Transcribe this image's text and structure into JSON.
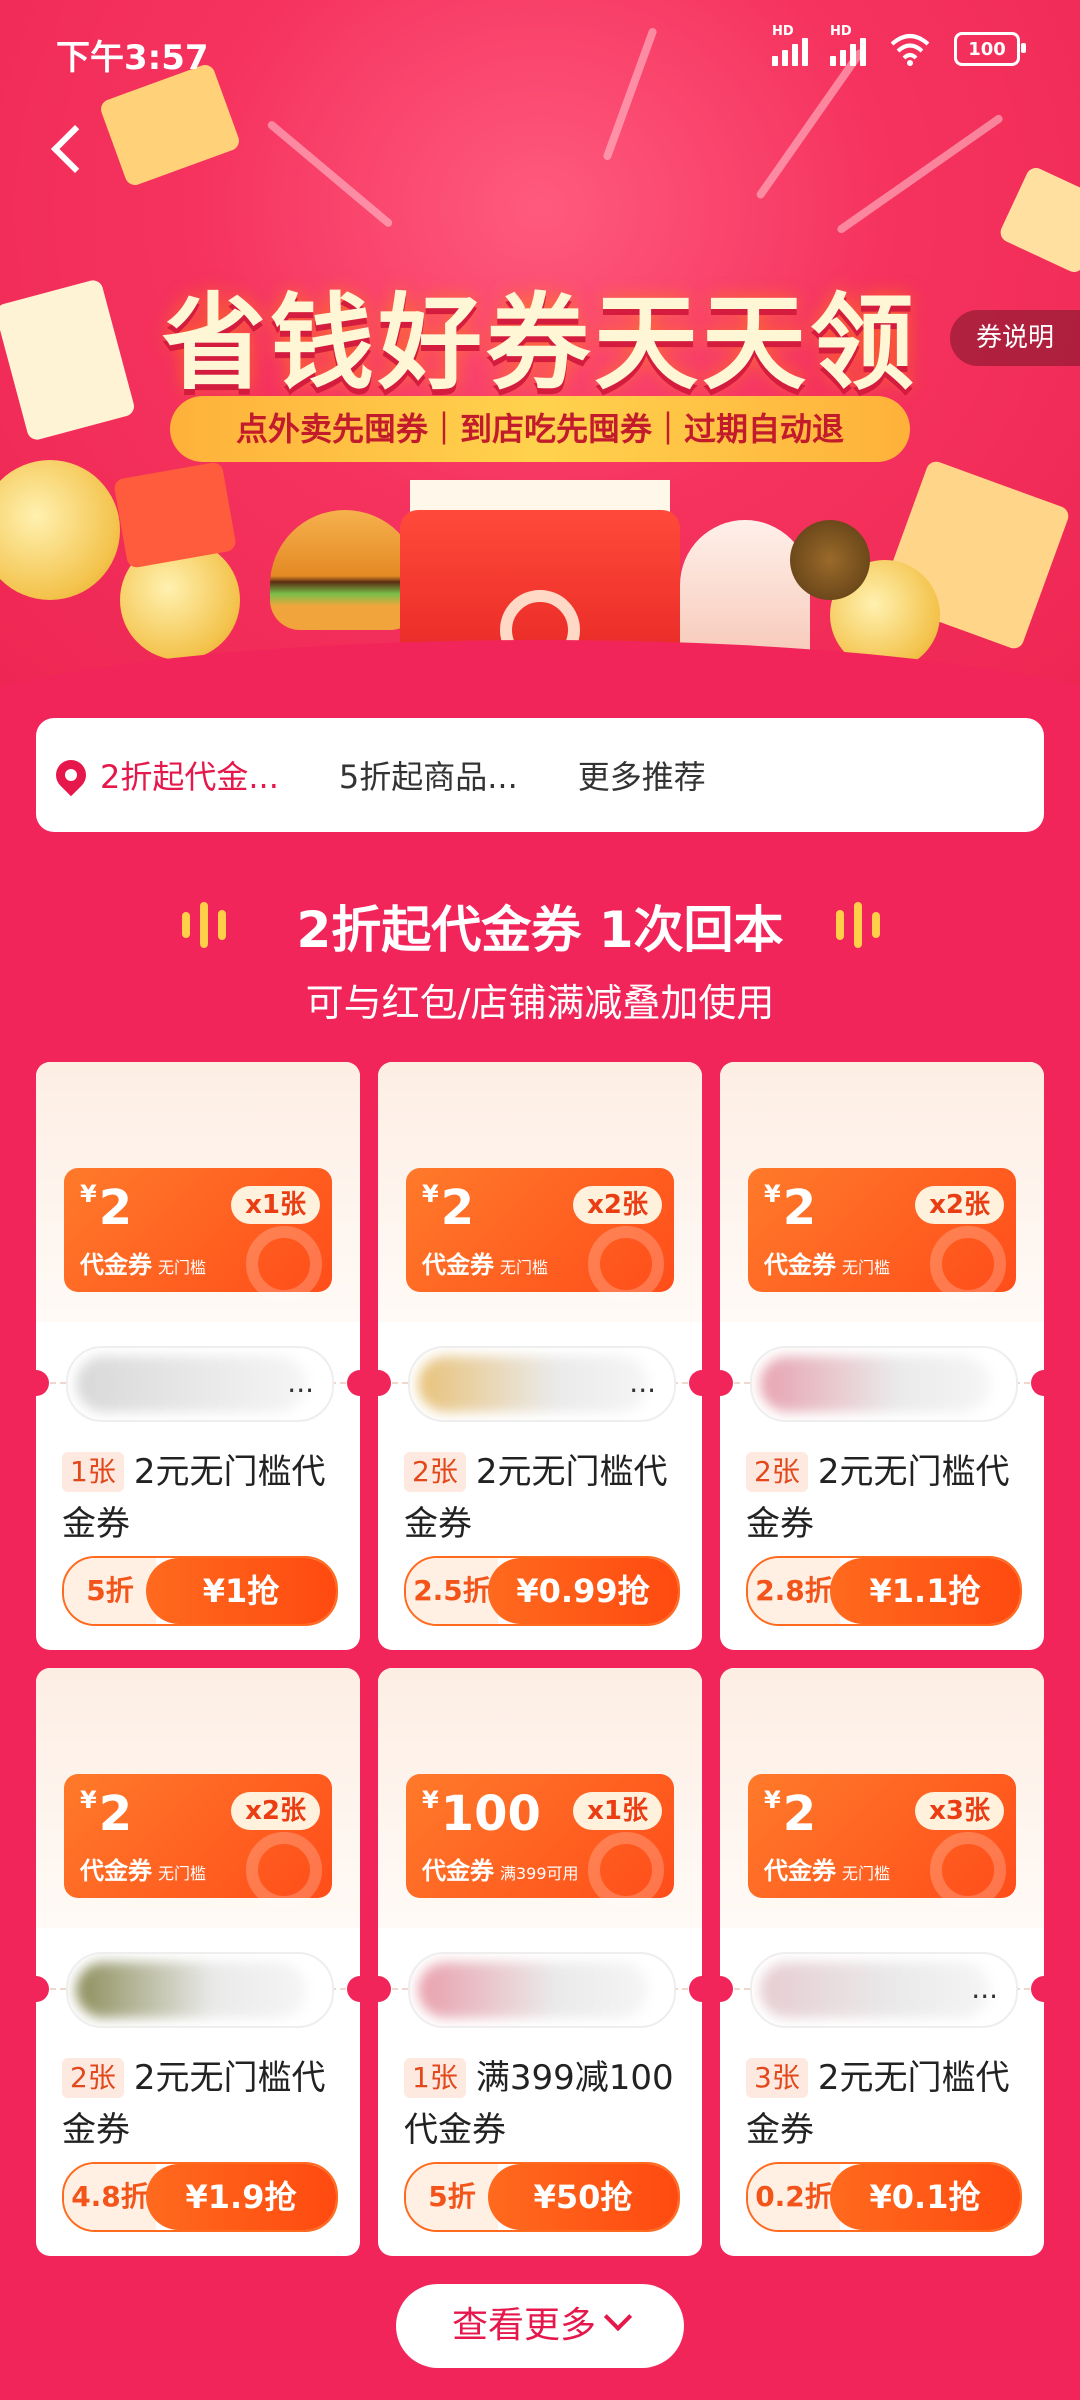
{
  "status_bar": {
    "time": "下午3:57",
    "hd1": "HD",
    "hd2": "HD",
    "battery": "100"
  },
  "header": {
    "title": "省钱好券天天领",
    "subtitle": "点外卖先囤券｜到店吃先囤券｜过期自动退",
    "coupon_note": "券说明"
  },
  "tabs": [
    {
      "label": "2折起代金..."
    },
    {
      "label": "5折起商品..."
    },
    {
      "label": "更多推荐"
    }
  ],
  "section": {
    "title": "2折起代金券 1次回本",
    "subtitle": "可与红包/店铺满减叠加使用"
  },
  "cards": [
    {
      "currency": "¥",
      "amount": "2",
      "count": "x1张",
      "label": "代金券",
      "threshold": "无门槛",
      "qty": "1张",
      "desc": "2元无门槛代金券",
      "discount": "5折",
      "price": "¥1抢",
      "dots": "...",
      "blur_color": "#d8d8d8"
    },
    {
      "currency": "¥",
      "amount": "2",
      "count": "x2张",
      "label": "代金券",
      "threshold": "无门槛",
      "qty": "2张",
      "desc": "2元无门槛代金券",
      "discount": "2.5折",
      "price": "¥0.99抢",
      "dots": "...",
      "blur_color": "#e8c27a"
    },
    {
      "currency": "¥",
      "amount": "2",
      "count": "x2张",
      "label": "代金券",
      "threshold": "无门槛",
      "qty": "2张",
      "desc": "2元无门槛代金券",
      "discount": "2.8折",
      "price": "¥1.1抢",
      "dots": "",
      "blur_color": "#e7a3b0"
    },
    {
      "currency": "¥",
      "amount": "2",
      "count": "x2张",
      "label": "代金券",
      "threshold": "无门槛",
      "qty": "2张",
      "desc": "2元无门槛代金券",
      "discount": "4.8折",
      "price": "¥1.9抢",
      "dots": "",
      "blur_color": "#8d8f5c"
    },
    {
      "currency": "¥",
      "amount": "100",
      "count": "x1张",
      "label": "代金券",
      "threshold": "满399可用",
      "qty": "1张",
      "desc": "满399减100代金券",
      "discount": "5折",
      "price": "¥50抢",
      "dots": "",
      "blur_color": "#e9a0ac"
    },
    {
      "currency": "¥",
      "amount": "2",
      "count": "x3张",
      "label": "代金券",
      "threshold": "无门槛",
      "qty": "3张",
      "desc": "2元无门槛代金券",
      "discount": "0.2折",
      "price": "¥0.1抢",
      "dots": "...",
      "blur_color": "#e6cdd2"
    }
  ],
  "more_button": {
    "label": "查看更多"
  },
  "colors": {
    "page_bg": "#f2255a",
    "accent": "#e5174b",
    "voucher": "#ff5a1f"
  }
}
